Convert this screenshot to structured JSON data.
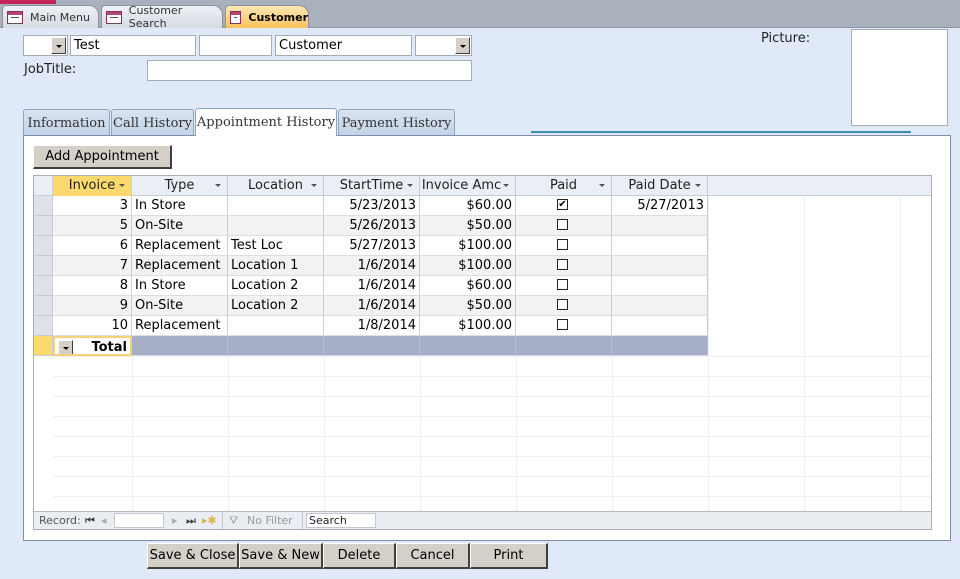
{
  "doc_tabs": [
    {
      "label": "Main Menu",
      "active": false
    },
    {
      "label": "Customer Search",
      "active": false
    },
    {
      "label": "Customer",
      "active": true
    }
  ],
  "header": {
    "title_combo_value": "",
    "first_name": "Test",
    "middle_name": "",
    "last_name": "Customer",
    "suffix_combo_value": "",
    "jobtitle_label": "JobTitle:",
    "jobtitle_value": "",
    "picture_label": "Picture:"
  },
  "tabs": [
    {
      "label": "Information",
      "active": false
    },
    {
      "label": "Call History",
      "active": false
    },
    {
      "label": "Appointment History",
      "active": true
    },
    {
      "label": "Payment History",
      "active": false
    }
  ],
  "add_button_label": "Add Appointment",
  "datasheet": {
    "columns": [
      "Invoice",
      "Type",
      "Location",
      "StartTime",
      "Invoice Amc",
      "Paid",
      "Paid Date"
    ],
    "rows": [
      {
        "invoice": "3",
        "type": "In Store",
        "location": "",
        "start": "5/23/2013",
        "amount": "$60.00",
        "paid": true,
        "paid_date": "5/27/2013"
      },
      {
        "invoice": "5",
        "type": "On-Site",
        "location": "",
        "start": "5/26/2013",
        "amount": "$50.00",
        "paid": false,
        "paid_date": ""
      },
      {
        "invoice": "6",
        "type": "Replacement",
        "location": "Test Loc",
        "start": "5/27/2013",
        "amount": "$100.00",
        "paid": false,
        "paid_date": ""
      },
      {
        "invoice": "7",
        "type": "Replacement",
        "location": "Location 1",
        "start": "1/6/2014",
        "amount": "$100.00",
        "paid": false,
        "paid_date": ""
      },
      {
        "invoice": "8",
        "type": "In Store",
        "location": "Location 2",
        "start": "1/6/2014",
        "amount": "$60.00",
        "paid": false,
        "paid_date": ""
      },
      {
        "invoice": "9",
        "type": "On-Site",
        "location": "Location 2",
        "start": "1/6/2014",
        "amount": "$50.00",
        "paid": false,
        "paid_date": ""
      },
      {
        "invoice": "10",
        "type": "Replacement",
        "location": "",
        "start": "1/8/2014",
        "amount": "$100.00",
        "paid": false,
        "paid_date": ""
      }
    ],
    "total_label": "Total"
  },
  "navbar": {
    "record_label": "Record:",
    "record_value": "",
    "filter_label": "No Filter",
    "search_label": "Search"
  },
  "commands": [
    "Save & Close",
    "Save & New",
    "Delete",
    "Cancel",
    "Print"
  ]
}
